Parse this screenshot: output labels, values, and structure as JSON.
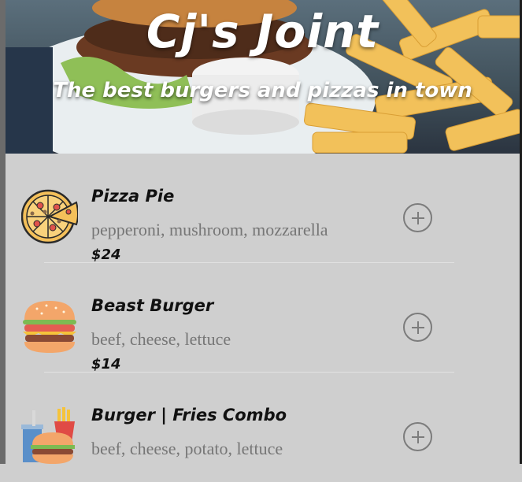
{
  "hero": {
    "title": "Cj's Joint",
    "subtitle": "The best burgers and pizzas in town"
  },
  "menu": {
    "items": [
      {
        "name": "Pizza Pie",
        "description": "pepperoni, mushroom, mozzarella",
        "price": "$24",
        "icon": "pizza-icon"
      },
      {
        "name": "Beast Burger",
        "description": "beef, cheese, lettuce",
        "price": "$14",
        "icon": "burger-icon"
      },
      {
        "name": "Burger | Fries Combo",
        "description": "beef, cheese, potato, lettuce",
        "price": "",
        "icon": "combo-meal-icon"
      }
    ]
  }
}
